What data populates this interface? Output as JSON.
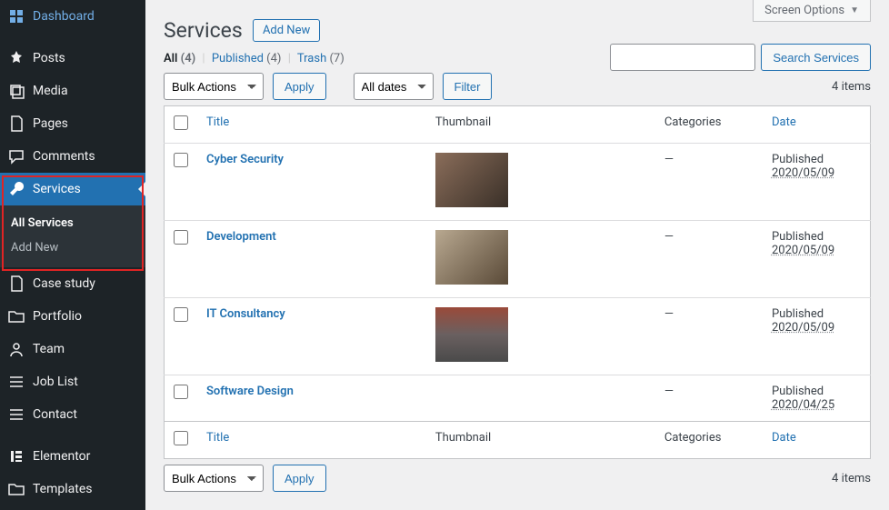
{
  "sidebar": {
    "items": [
      {
        "label": "Dashboard",
        "icon": "dashboard"
      },
      {
        "label": "Posts",
        "icon": "pin"
      },
      {
        "label": "Media",
        "icon": "media"
      },
      {
        "label": "Pages",
        "icon": "pages"
      },
      {
        "label": "Comments",
        "icon": "comments"
      },
      {
        "label": "Services",
        "icon": "wrench",
        "active": true
      },
      {
        "label": "Case study",
        "icon": "pages"
      },
      {
        "label": "Portfolio",
        "icon": "folder"
      },
      {
        "label": "Team",
        "icon": "user"
      },
      {
        "label": "Job List",
        "icon": "list"
      },
      {
        "label": "Contact",
        "icon": "list"
      },
      {
        "label": "Elementor",
        "icon": "elementor"
      },
      {
        "label": "Templates",
        "icon": "folder"
      }
    ],
    "submenu": {
      "all": "All Services",
      "add": "Add New"
    }
  },
  "screen_options": "Screen Options",
  "page": {
    "title": "Services",
    "add_new": "Add New"
  },
  "filters": {
    "all_label": "All",
    "all_count": "(4)",
    "published_label": "Published",
    "published_count": "(4)",
    "trash_label": "Trash",
    "trash_count": "(7)"
  },
  "search": {
    "button": "Search Services",
    "value": ""
  },
  "bulk": {
    "label": "Bulk Actions",
    "apply": "Apply"
  },
  "datefilter": {
    "label": "All dates",
    "filter": "Filter"
  },
  "items_count": "4 items",
  "columns": {
    "title": "Title",
    "thumbnail": "Thumbnail",
    "categories": "Categories",
    "date": "Date"
  },
  "rows": [
    {
      "title": "Cyber Security",
      "categories": "—",
      "status": "Published",
      "date": "2020/05/09",
      "thumb": "t1"
    },
    {
      "title": "Development",
      "categories": "—",
      "status": "Published",
      "date": "2020/05/09",
      "thumb": "t2"
    },
    {
      "title": "IT Consultancy",
      "categories": "—",
      "status": "Published",
      "date": "2020/05/09",
      "thumb": "t3"
    },
    {
      "title": "Software Design",
      "categories": "—",
      "status": "Published",
      "date": "2020/04/25",
      "thumb": ""
    }
  ]
}
